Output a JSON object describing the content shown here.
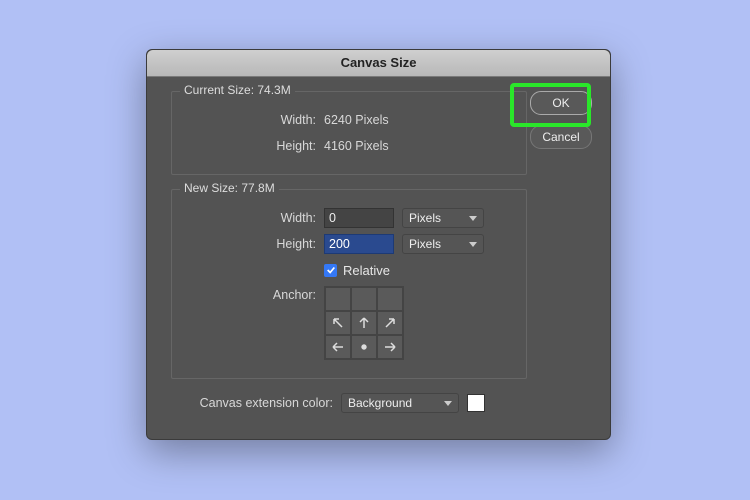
{
  "dialog": {
    "title": "Canvas Size",
    "currentSize": {
      "legend": "Current Size: 74.3M",
      "widthLabel": "Width:",
      "widthValue": "6240 Pixels",
      "heightLabel": "Height:",
      "heightValue": "4160 Pixels"
    },
    "newSize": {
      "legend": "New Size: 77.8M",
      "widthLabel": "Width:",
      "widthValue": "0",
      "widthUnit": "Pixels",
      "heightLabel": "Height:",
      "heightValue": "200",
      "heightUnit": "Pixels",
      "relativeLabel": "Relative",
      "relativeChecked": true,
      "anchorLabel": "Anchor:"
    },
    "extension": {
      "label": "Canvas extension color:",
      "value": "Background",
      "swatch": "#ffffff"
    },
    "buttons": {
      "ok": "OK",
      "cancel": "Cancel"
    }
  }
}
